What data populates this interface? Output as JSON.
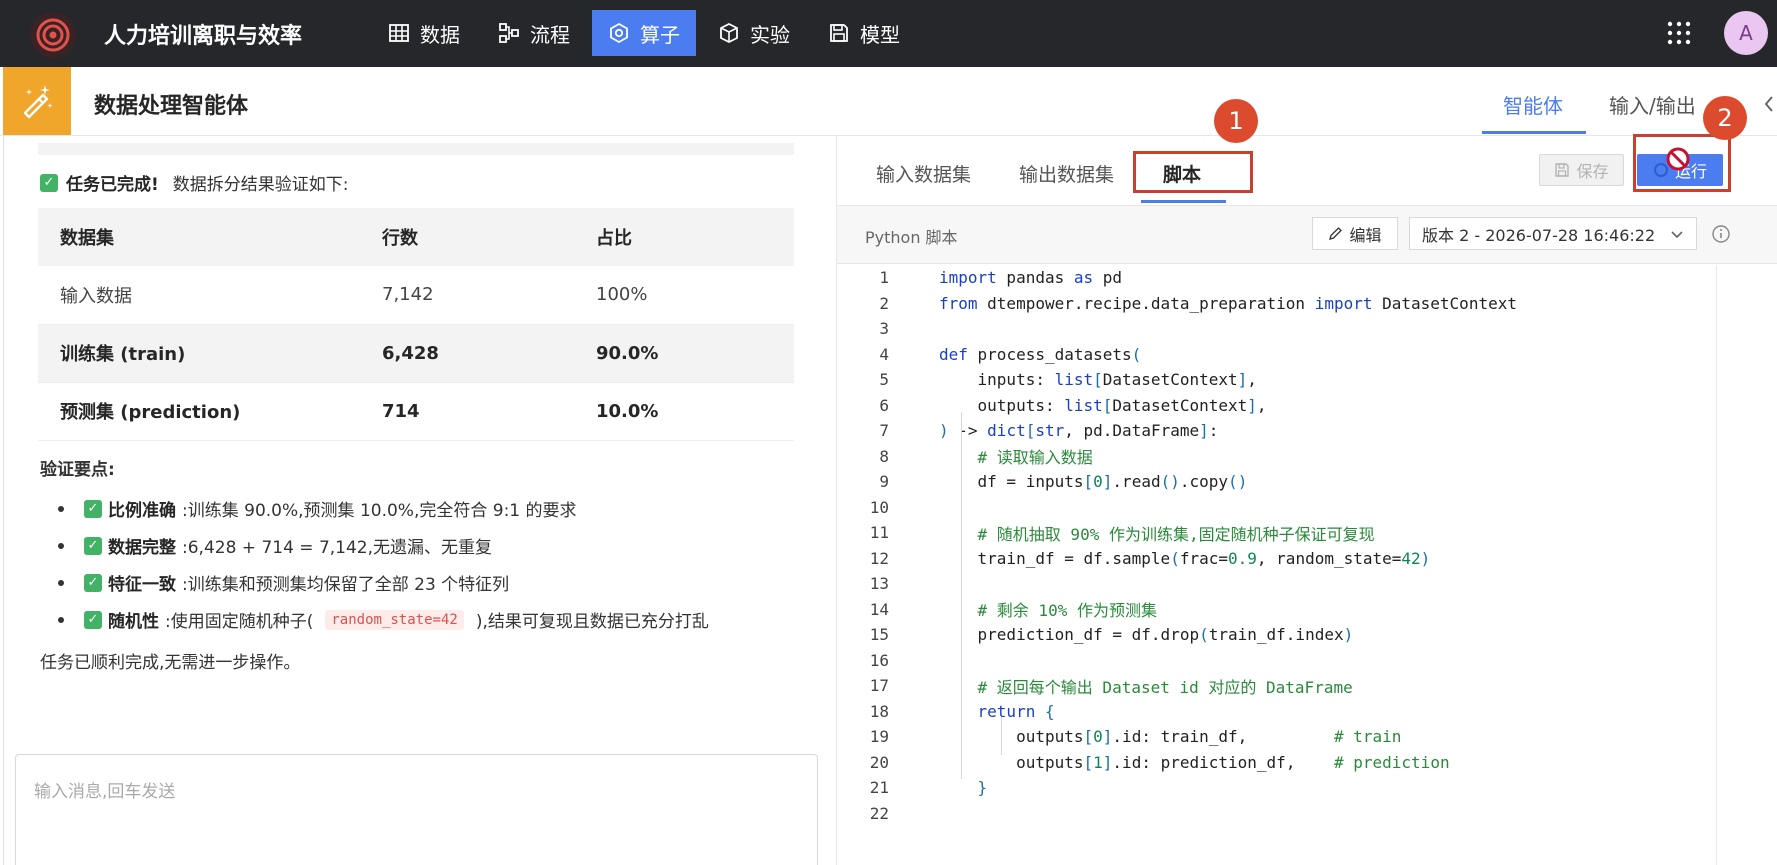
{
  "app": {
    "title": "人力培训离职与效率",
    "nav": [
      {
        "label": "数据",
        "icon": "table-icon",
        "active": false
      },
      {
        "label": "流程",
        "icon": "flow-icon",
        "active": false
      },
      {
        "label": "算子",
        "icon": "operator-icon",
        "active": true
      },
      {
        "label": "实验",
        "icon": "cube-icon",
        "active": false
      },
      {
        "label": "模型",
        "icon": "model-icon",
        "active": false
      }
    ],
    "avatar_letter": "A",
    "accent_color": "#4c7df0"
  },
  "header": {
    "page_title": "数据处理智能体",
    "tabs": [
      "智能体",
      "输入/输出"
    ]
  },
  "left": {
    "status_bold": "任务已完成!",
    "status_text": "数据拆分结果验证如下:",
    "table": {
      "headers": [
        "数据集",
        "行数",
        "占比"
      ],
      "rows": [
        [
          "输入数据",
          "7,142",
          "100%"
        ],
        [
          "训练集 (train)",
          "6,428",
          "90.0%"
        ],
        [
          "预测集 (prediction)",
          "714",
          "10.0%"
        ]
      ]
    },
    "verify_title": "验证要点:",
    "verify_items": [
      {
        "bold": "比例准确",
        "text": ":训练集 90.0%,预测集 10.0%,完全符合 9:1 的要求"
      },
      {
        "bold": "数据完整",
        "text": ":6,428 + 714 = 7,142,无遗漏、无重复"
      },
      {
        "bold": "特征一致",
        "text": ":训练集和预测集均保留了全部 23 个特征列"
      },
      {
        "bold": "随机性",
        "text_before": ":使用固定随机种子(",
        "code": "random_state=42",
        "text_after": "),结果可复现且数据已充分打乱"
      }
    ],
    "final_note": "任务已顺利完成,无需进一步操作。",
    "message_placeholder": "输入消息,回车发送"
  },
  "right": {
    "tabs": [
      "输入数据集",
      "输出数据集",
      "脚本"
    ],
    "save_label": "保存",
    "run_label": "运行",
    "script_label": "Python 脚本",
    "edit_label": "编辑",
    "version_label": "版本 2 - 2026-07-28 16:46:22",
    "badges": [
      "1",
      "2"
    ]
  },
  "code_lines": [
    "import pandas as pd",
    "from dtempower.recipe.data_preparation import DatasetContext",
    "",
    "def process_datasets(",
    "    inputs: list[DatasetContext],",
    "    outputs: list[DatasetContext],",
    ") -> dict[str, pd.DataFrame]:",
    "    # 读取输入数据",
    "    df = inputs[0].read().copy()",
    "",
    "    # 随机抽取 90% 作为训练集,固定随机种子保证可复现",
    "    train_df = df.sample(frac=0.9, random_state=42)",
    "",
    "    # 剩余 10% 作为预测集",
    "    prediction_df = df.drop(train_df.index)",
    "",
    "    # 返回每个输出 Dataset id 对应的 DataFrame",
    "    return {",
    "        outputs[0].id: train_df,         # train",
    "        outputs[1].id: prediction_df,    # prediction",
    "    }",
    ""
  ]
}
